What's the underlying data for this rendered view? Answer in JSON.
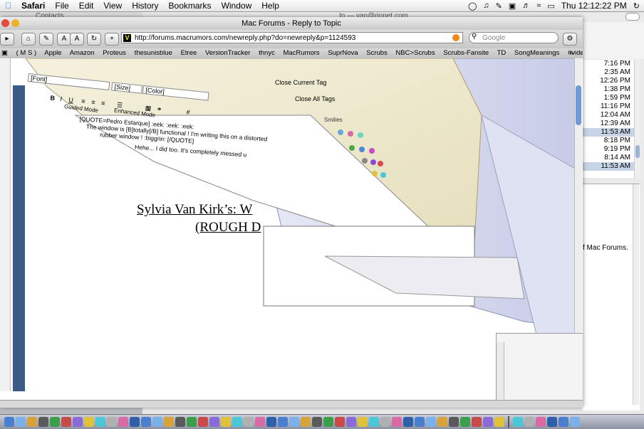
{
  "menubar": {
    "apple": "",
    "items": [
      "Safari",
      "File",
      "Edit",
      "View",
      "History",
      "Bookmarks",
      "Window",
      "Help"
    ],
    "clock": "Thu 12:12:22 PM"
  },
  "background": {
    "contacts_title": "Contacts",
    "mail_title": "In — van@rinnet.com",
    "times": [
      "7:16 PM",
      "2:35 AM",
      "12:26 PM",
      "1:38 PM",
      "1:59 PM",
      "11:16 PM",
      "12:04 AM",
      "12:39 AM",
      "11:53 AM",
      "8:18 PM",
      "9:19 PM",
      "8:14 AM",
      "11:53 AM"
    ],
    "selected_rows": [
      8,
      12
    ],
    "footer_text": "f Mac Forums."
  },
  "browser": {
    "title": "Mac Forums - Reply to Topic",
    "url": "http://forums.macrumors.com/newreply.php?do=newreply&p=1124593",
    "search_placeholder": "Google",
    "bookmarks": [
      "( M S )",
      "Apple",
      "Amazon",
      "Proteus",
      "thesunisblue",
      "Etree",
      "VersionTracker",
      "thnyc",
      "MacRumors",
      "SuprNova",
      "Scrubs",
      "NBC>Scrubs",
      "Scrubs-Fansite",
      "TD",
      "SongMeanings",
      "#videopimp"
    ],
    "bookmarks_more": "»"
  },
  "editor": {
    "font_select": "[Font]",
    "size_select": "[Size]",
    "color_select": "[Color]",
    "close_current": "Close Current Tag",
    "close_all": "Close All Tags",
    "guided_mode": "Guided Mode",
    "enhanced_mode": "Enhanced Mode",
    "smilies": "Smilies",
    "quote_lines": [
      "[QUOTE=Pedro Estarque] :eek: :eek: :eek:",
      "The window is [B]totally[/B] functional ! I'm writing this on a distorted",
      "rubber window ! :biggrin: [/QUOTE]"
    ],
    "reply_line": "Hehe... I did too. It's completely messed u"
  },
  "document": {
    "title": "Sylvia Van Kirk’s: W",
    "subtitle": "(ROUGH D"
  }
}
